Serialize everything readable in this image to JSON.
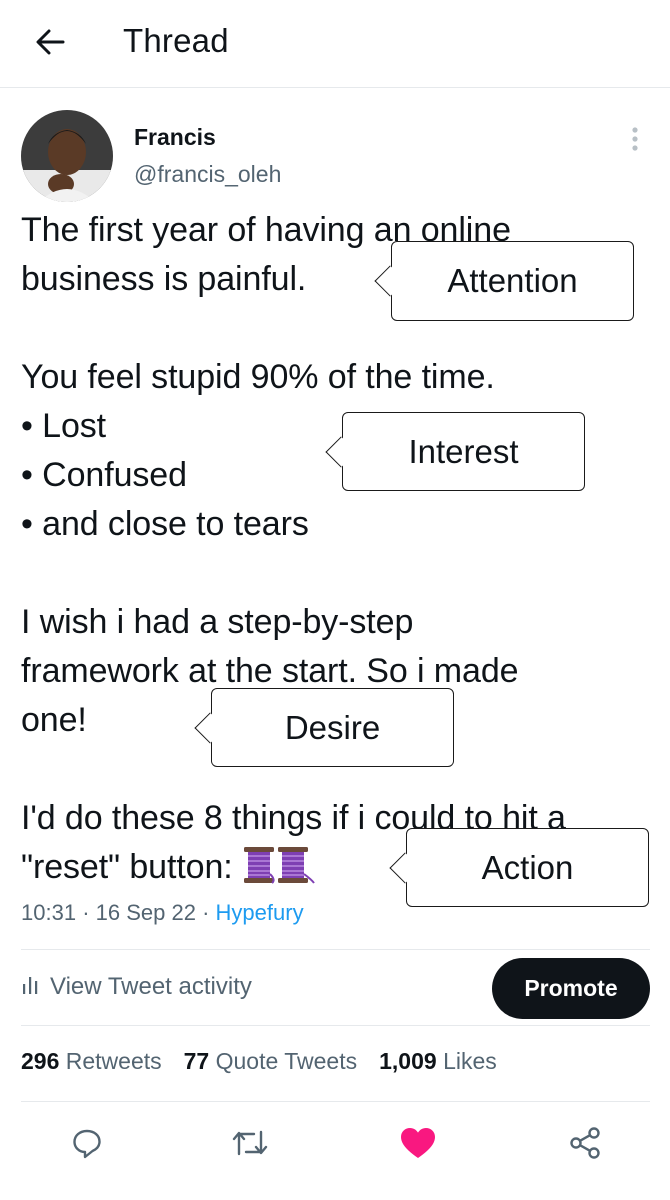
{
  "header": {
    "title": "Thread",
    "back_icon": "arrow-left-icon"
  },
  "author": {
    "name": "Francis",
    "handle": "@francis_oleh"
  },
  "tweet": {
    "text": "The first year of having an online\nbusiness is painful.\n\nYou feel stupid 90% of the time.\n• Lost\n• Confused\n• and close to tears\n\nI wish i had a step-by-step\nframework at the start. So i made\none!\n\nI'd do these 8 things if i could to hit a\n\"reset\" button: ",
    "time": "10:31",
    "date": "16 Sep 22",
    "source": "Hypefury",
    "emoji": "thread-spool"
  },
  "callouts": {
    "attention": "Attention",
    "interest": "Interest",
    "desire": "Desire",
    "action": "Action"
  },
  "activity": {
    "label": "View Tweet activity",
    "promote": "Promote"
  },
  "stats": {
    "retweets_count": "296",
    "retweets_label": "Retweets",
    "quotes_count": "77",
    "quotes_label": "Quote Tweets",
    "likes_count": "1,009",
    "likes_label": "Likes"
  },
  "actions": [
    "reply-icon",
    "retweet-icon",
    "like-icon",
    "share-icon"
  ],
  "colors": {
    "like": "#f91880",
    "link": "#1d9bf0",
    "muted": "#536471",
    "promote_bg": "#0f1419"
  }
}
